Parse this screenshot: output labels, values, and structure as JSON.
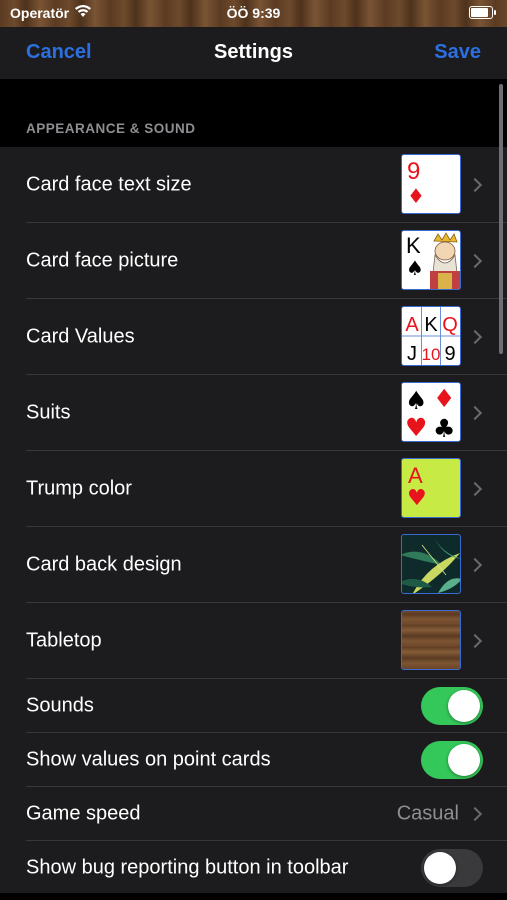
{
  "status_bar": {
    "carrier": "Operatör",
    "time": "ÖÖ 9:39"
  },
  "nav": {
    "cancel": "Cancel",
    "title": "Settings",
    "save": "Save"
  },
  "section": {
    "header": "APPEARANCE & SOUND"
  },
  "rows": [
    {
      "label": "Card face text size",
      "thumb": {
        "rank": "9",
        "suit": "♦"
      }
    },
    {
      "label": "Card face picture",
      "thumb": {
        "rank": "K",
        "suit": "♠"
      }
    },
    {
      "label": "Card Values",
      "thumb": {
        "cells": [
          "A",
          "K",
          "Q",
          "J",
          "10",
          "9"
        ]
      }
    },
    {
      "label": "Suits",
      "thumb": {
        "suits": [
          "♠",
          "♦",
          "♥",
          "♣"
        ]
      }
    },
    {
      "label": "Trump color",
      "thumb": {
        "rank": "A",
        "suit": "♥",
        "color": "#c8ea45"
      }
    },
    {
      "label": "Card back design",
      "thumb": {
        "pattern": "tropical-leaves"
      }
    },
    {
      "label": "Tabletop",
      "thumb": {
        "pattern": "wood"
      }
    }
  ],
  "toggles": [
    {
      "label": "Sounds",
      "on": true
    },
    {
      "label": "Show values on point cards",
      "on": true
    }
  ],
  "game_speed": {
    "label": "Game speed",
    "value": "Casual"
  },
  "bug_button": {
    "label": "Show bug reporting button in toolbar",
    "on": false
  },
  "colors": {
    "accent": "#2b6fe0",
    "toggle_on": "#34c759",
    "red": "#e8141c"
  }
}
